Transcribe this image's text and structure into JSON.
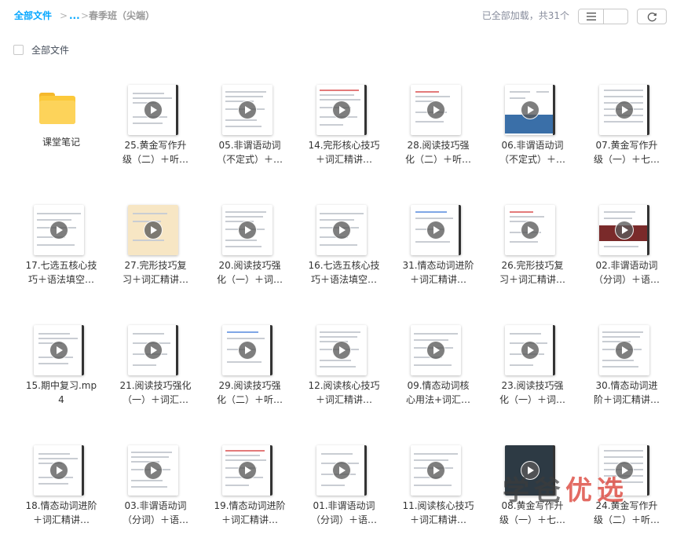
{
  "breadcrumb": {
    "root": "全部文件",
    "sep": ">",
    "ellipsis": "...",
    "current": "春季班（尖端）"
  },
  "status": {
    "loaded_text": "已全部加载，共31个"
  },
  "toolbar": {
    "list_view_icon": "list-icon",
    "grid_view_icon": "grid-icon",
    "refresh_icon": "refresh-icon"
  },
  "select_all": {
    "label": "全部文件"
  },
  "items": [
    {
      "type": "folder",
      "l1": "课堂笔记",
      "l2": ""
    },
    {
      "type": "video",
      "l1": "25.黄金写作升",
      "l2": "级（二）＋听…"
    },
    {
      "type": "video",
      "l1": "05.非谓语动词",
      "l2": "（不定式）＋…"
    },
    {
      "type": "video",
      "l1": "14.完形核心技巧",
      "l2": "＋词汇精讲…"
    },
    {
      "type": "video",
      "l1": "28.阅读技巧强",
      "l2": "化（二）＋听…"
    },
    {
      "type": "video",
      "l1": "06.非谓语动词",
      "l2": "（不定式）＋…"
    },
    {
      "type": "video",
      "l1": "07.黄金写作升",
      "l2": "级（一）＋七…"
    },
    {
      "type": "video",
      "l1": "17.七选五核心技",
      "l2": "巧＋语法填空…"
    },
    {
      "type": "video",
      "l1": "27.完形技巧复",
      "l2": "习＋词汇精讲…"
    },
    {
      "type": "video",
      "l1": "20.阅读技巧强",
      "l2": "化（一）＋词…"
    },
    {
      "type": "video",
      "l1": "16.七选五核心技",
      "l2": "巧＋语法填空…"
    },
    {
      "type": "video",
      "l1": "31.情态动词进阶",
      "l2": "＋词汇精讲…"
    },
    {
      "type": "video",
      "l1": "26.完形技巧复",
      "l2": "习＋词汇精讲…"
    },
    {
      "type": "video",
      "l1": "02.非谓语动词",
      "l2": "（分词）＋语…"
    },
    {
      "type": "video",
      "l1": "15.期中复习.mp",
      "l2": "4"
    },
    {
      "type": "video",
      "l1": "21.阅读技巧强化",
      "l2": "（一）＋词汇…"
    },
    {
      "type": "video",
      "l1": "29.阅读技巧强",
      "l2": "化（二）＋听…"
    },
    {
      "type": "video",
      "l1": "12.阅读核心技巧",
      "l2": "＋词汇精讲…"
    },
    {
      "type": "video",
      "l1": "09.情态动词核",
      "l2": "心用法+词汇…"
    },
    {
      "type": "video",
      "l1": "23.阅读技巧强",
      "l2": "化（一）＋词…"
    },
    {
      "type": "video",
      "l1": "30.情态动词进",
      "l2": "阶＋词汇精讲…"
    },
    {
      "type": "video",
      "l1": "18.情态动词进阶",
      "l2": "＋词汇精讲…"
    },
    {
      "type": "video",
      "l1": "03.非谓语动词",
      "l2": "（分词）＋语…"
    },
    {
      "type": "video",
      "l1": "19.情态动词进阶",
      "l2": "＋词汇精讲…"
    },
    {
      "type": "video",
      "l1": "01.非谓语动词",
      "l2": "（分词）＋语…"
    },
    {
      "type": "video",
      "l1": "11.阅读核心技巧",
      "l2": "＋词汇精讲…"
    },
    {
      "type": "video",
      "l1": "08.黄金写作升",
      "l2": "级（一）＋七…"
    },
    {
      "type": "video",
      "l1": "24.黄金写作升",
      "l2": "级（二）＋听…"
    }
  ],
  "watermark": {
    "part1": "学爸",
    "part2": "优选"
  },
  "colors": {
    "accent": "#06a7ff",
    "folder": "#fcc93a"
  }
}
